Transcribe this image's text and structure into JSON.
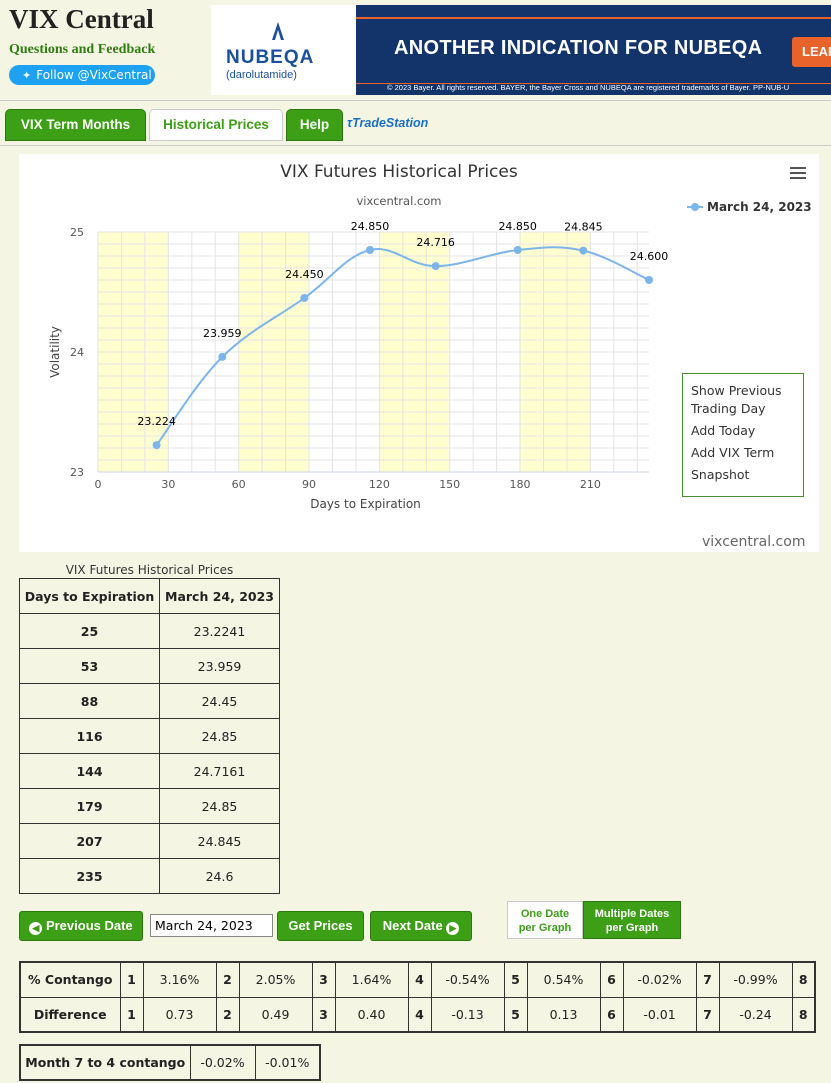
{
  "header": {
    "site_title": "VIX Central",
    "questions_link": "Questions and Feedback",
    "follow_button": "Follow @VixCentral"
  },
  "ad": {
    "brand": "NUBEQA",
    "brand_sub": "(darolutamide)",
    "headline": "ANOTHER INDICATION FOR NUBEQA",
    "cta": "LEAR",
    "fine_print": "© 2023 Bayer. All rights reserved. BAYER, the Bayer Cross and NUBEQA are registered trademarks of Bayer.  PP-NUB-U"
  },
  "tabs": [
    {
      "label": "VIX Term Months",
      "active": false
    },
    {
      "label": "Historical Prices",
      "active": true
    },
    {
      "label": "Help",
      "active": false
    }
  ],
  "tradestation_label": "TradeStation",
  "chart_menu": {
    "items": [
      "Show Previous Trading Day",
      "Add Today",
      "Add VIX Term",
      "Snapshot"
    ]
  },
  "chart_watermark": "vixcentral.com",
  "chart_data": {
    "type": "line",
    "title": "VIX Futures Historical Prices",
    "subtitle": "vixcentral.com",
    "xlabel": "Days to Expiration",
    "ylabel": "Volatility",
    "x_ticks": [
      0,
      30,
      60,
      90,
      120,
      150,
      180,
      210
    ],
    "y_ticks": [
      23,
      24,
      25
    ],
    "xlim": [
      0,
      235
    ],
    "ylim": [
      23,
      25
    ],
    "grid": true,
    "shaded_bands": [
      [
        0,
        30
      ],
      [
        60,
        90
      ],
      [
        120,
        150
      ],
      [
        180,
        210
      ]
    ],
    "legend_position": "top-right",
    "color": "#7cb5ec",
    "series": [
      {
        "name": "March 24, 2023",
        "x": [
          25,
          53,
          88,
          116,
          144,
          179,
          207,
          235
        ],
        "y": [
          23.224,
          23.959,
          24.45,
          24.85,
          24.716,
          24.85,
          24.845,
          24.6
        ],
        "labels": [
          "23.224",
          "23.959",
          "24.450",
          "24.850",
          "24.716",
          "24.850",
          "24.845",
          "24.600"
        ]
      }
    ]
  },
  "table": {
    "caption": "VIX Futures Historical Prices",
    "headers": [
      "Days to Expiration",
      "March 24, 2023"
    ],
    "rows": [
      [
        "25",
        "23.2241"
      ],
      [
        "53",
        "23.959"
      ],
      [
        "88",
        "24.45"
      ],
      [
        "116",
        "24.85"
      ],
      [
        "144",
        "24.7161"
      ],
      [
        "179",
        "24.85"
      ],
      [
        "207",
        "24.845"
      ],
      [
        "235",
        "24.6"
      ]
    ]
  },
  "controls": {
    "prev_button": "Previous Date",
    "date_value": "March 24, 2023",
    "get_prices": "Get Prices",
    "next_button": "Next Date",
    "toggle_one_line1": "One Date",
    "toggle_one_line2": "per Graph",
    "toggle_multi_line1": "Multiple Dates",
    "toggle_multi_line2": "per Graph"
  },
  "contango": {
    "row_label": "% Contango",
    "values": [
      "3.16%",
      "2.05%",
      "1.64%",
      "-0.54%",
      "0.54%",
      "-0.02%",
      "-0.99%"
    ],
    "diff_label": "Difference",
    "diffs": [
      "0.73",
      "0.49",
      "0.40",
      "-0.13",
      "0.13",
      "-0.01",
      "-0.24"
    ],
    "months": [
      "1",
      "2",
      "3",
      "4",
      "5",
      "6",
      "7",
      "8"
    ]
  },
  "month74": {
    "label": "Month 7 to 4 contango",
    "values": [
      "-0.02%",
      "-0.01%"
    ]
  }
}
